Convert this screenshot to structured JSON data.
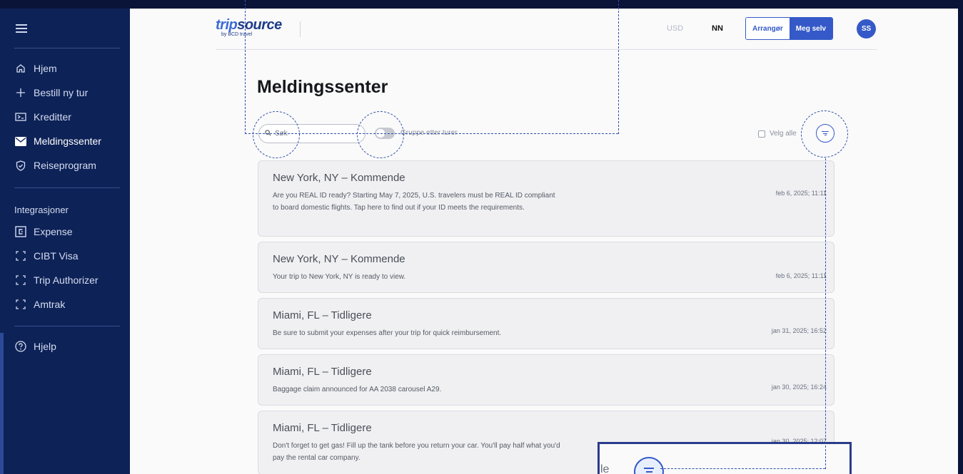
{
  "sidebar": {
    "menu_icon": "hamburger-menu-icon",
    "nav": [
      {
        "label": "Hjem",
        "icon": "home-icon"
      },
      {
        "label": "Bestill ny tur",
        "icon": "plus-icon"
      },
      {
        "label": "Kreditter",
        "icon": "ticket-icon"
      },
      {
        "label": "Meldingssenter",
        "icon": "envelope-icon",
        "active": true
      },
      {
        "label": "Reiseprogram",
        "icon": "shield-check-icon"
      }
    ],
    "integrations_label": "Integrasjoner",
    "integrations": [
      {
        "label": "Expense",
        "icon": "expense-icon"
      },
      {
        "label": "CIBT Visa",
        "icon": "frame-icon"
      },
      {
        "label": "Trip Authorizer",
        "icon": "frame-icon"
      },
      {
        "label": "Amtrak",
        "icon": "frame-icon"
      }
    ],
    "help": {
      "label": "Hjelp",
      "icon": "help-circle-icon"
    }
  },
  "header": {
    "logo_text_trip": "trip",
    "logo_text_source": "source",
    "logo_sub": "by BCD travel",
    "currency": "USD",
    "language": "NN",
    "role_options": [
      "Arrangør",
      "Meg selv"
    ],
    "avatar_initials": "SS"
  },
  "main": {
    "title": "Meldingssenter",
    "search_placeholder": "Søk",
    "group_toggle_label": "Gruppe etter turer",
    "select_all_label": "Velg alle",
    "messages": [
      {
        "title": "New York, NY – Kommende",
        "body": "Are you REAL ID ready? Starting May 7, 2025, U.S. travelers must be REAL ID compliant to board domestic flights. Tap here to find out if your ID meets the requirements.",
        "date": "feb 6, 2025; 11:11"
      },
      {
        "title": "New York, NY – Kommende",
        "body": "Your trip to New York, NY is ready to view.",
        "date": "feb 6, 2025; 11:11"
      },
      {
        "title": "Miami, FL – Tidligere",
        "body": "Be sure to submit your expenses after your trip for quick reimbursement.",
        "date": "jan 31, 2025; 16:52"
      },
      {
        "title": "Miami, FL – Tidligere",
        "body": "Baggage claim announced for AA 2038 carousel A29.",
        "date": "jan 30, 2025; 16:24"
      },
      {
        "title": "Miami, FL – Tidligere",
        "body": "Don't forget to get gas! Fill up the tank before you return your car. You'll pay half what you'd pay the rental car company.",
        "date": "jan 30, 2025; 12:07"
      }
    ]
  },
  "zoom_callout": {
    "fragment_text": "le"
  },
  "colors": {
    "sidebar_bg": "#0d2257",
    "accent": "#3559c8",
    "annotation": "#2f4faa"
  }
}
